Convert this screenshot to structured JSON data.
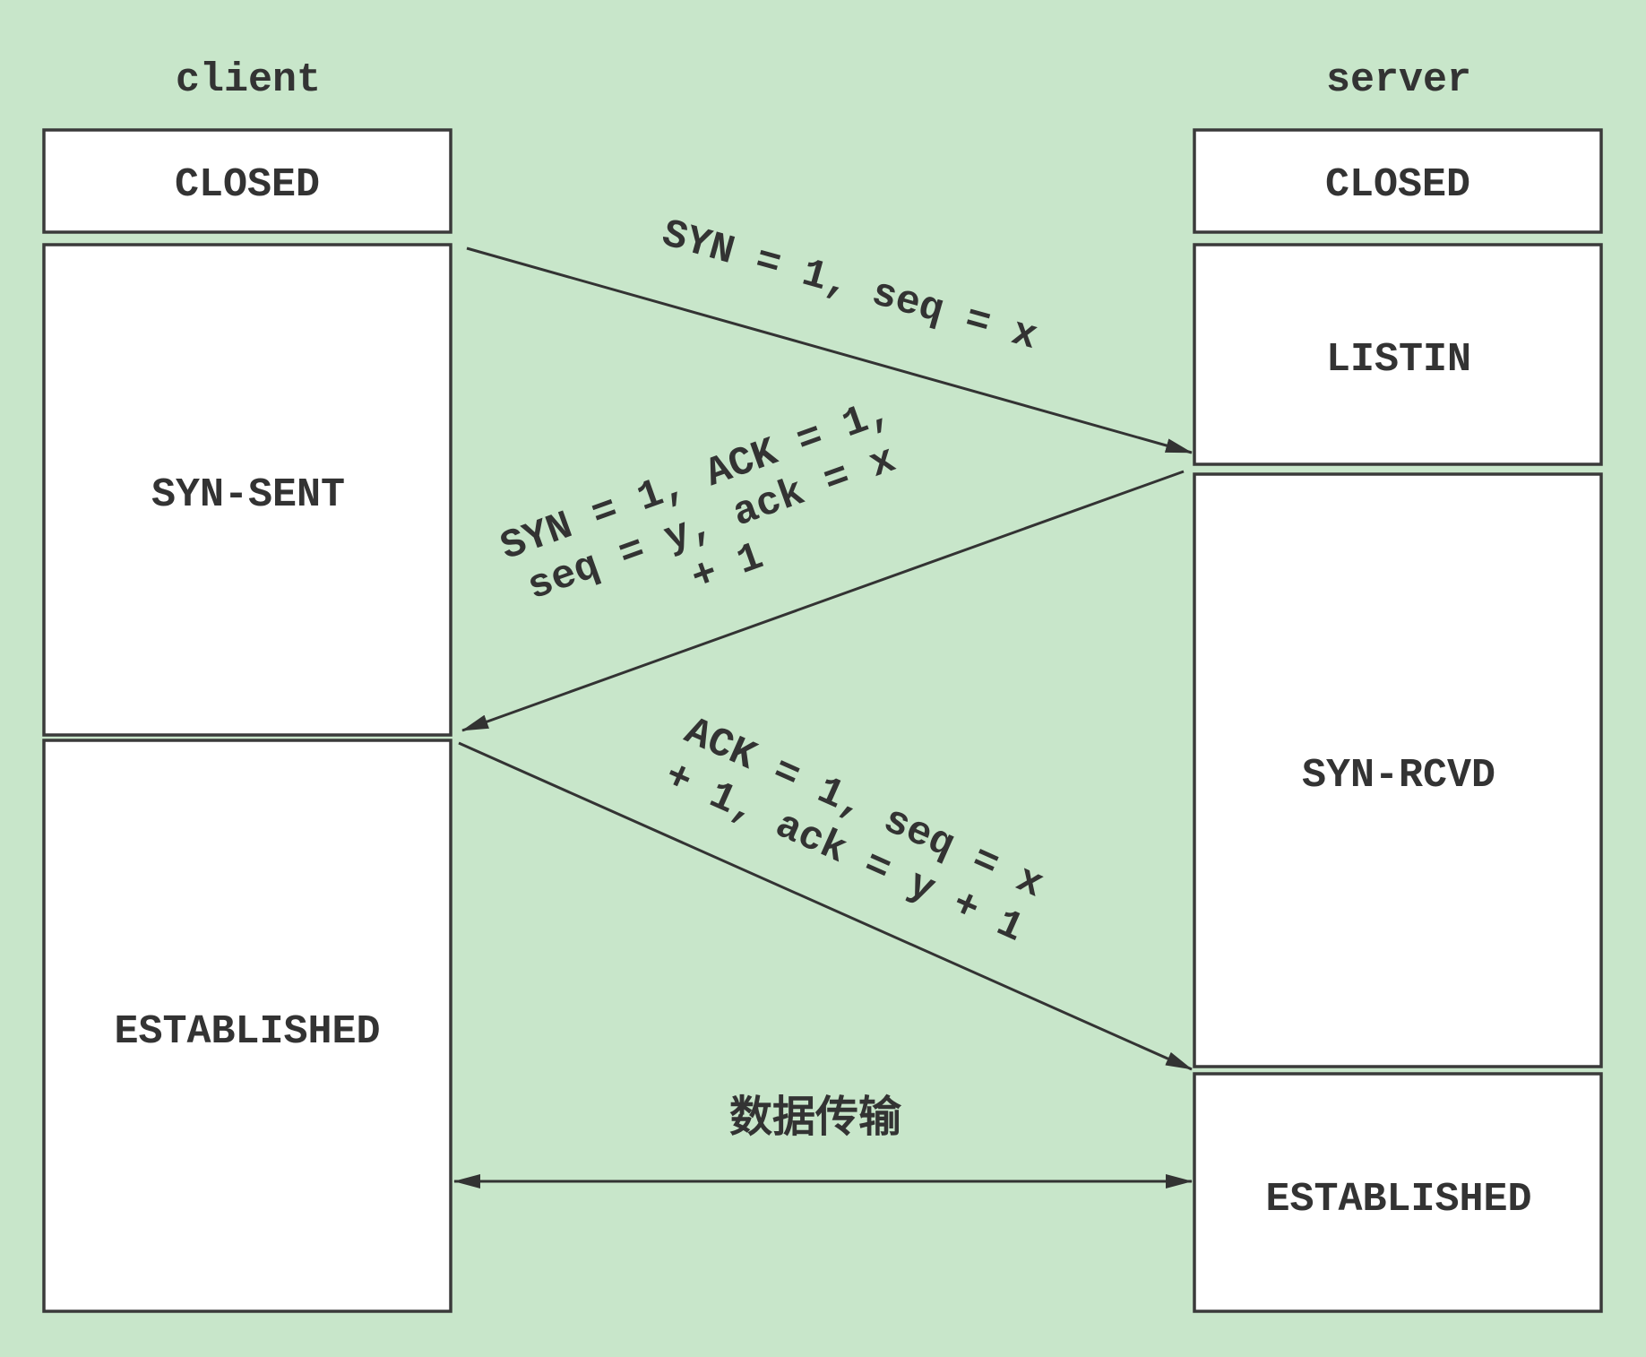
{
  "colors": {
    "background": "#c8e6ca",
    "box_fill": "#ffffff",
    "stroke": "#3a3a3a",
    "text": "#333333"
  },
  "client": {
    "title": "client",
    "states": {
      "closed": "CLOSED",
      "syn_sent": "SYN-SENT",
      "established": "ESTABLISHED"
    }
  },
  "server": {
    "title": "server",
    "states": {
      "closed": "CLOSED",
      "listen": "LISTIN",
      "syn_rcvd": "SYN-RCVD",
      "established": "ESTABLISHED"
    }
  },
  "messages": {
    "syn": [
      "SYN = 1, seq = x"
    ],
    "syn_ack": [
      "SYN = 1, ACK = 1,",
      "seq = y, ack = x",
      "+ 1"
    ],
    "ack": [
      "ACK = 1, seq = x",
      "+ 1, ack = y + 1"
    ]
  },
  "data_transfer": {
    "label": "数据传输"
  }
}
